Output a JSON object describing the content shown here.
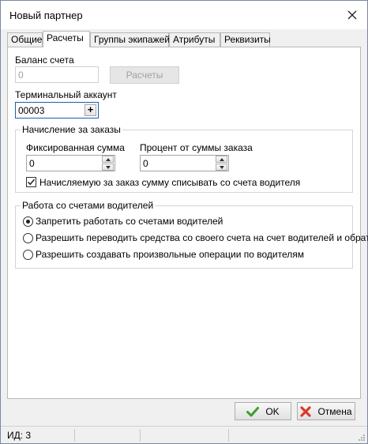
{
  "window": {
    "title": "Новый партнер"
  },
  "tabs": [
    {
      "label": "Общие"
    },
    {
      "label": "Расчеты"
    },
    {
      "label": "Группы экипажей"
    },
    {
      "label": "Атрибуты"
    },
    {
      "label": "Реквизиты"
    }
  ],
  "active_tab": "Расчеты",
  "balance": {
    "label": "Баланс счета",
    "value": "0",
    "button_label": "Расчеты"
  },
  "terminal": {
    "label": "Терминальный аккаунт",
    "value": "00003"
  },
  "accrual_group": {
    "title": "Начисление за заказы",
    "fixed_label": "Фиксированная сумма",
    "fixed_value": "0",
    "percent_label": "Процент от суммы заказа",
    "percent_value": "0",
    "checkbox_label": "Начисляемую за заказ сумму списывать со счета водителя",
    "checkbox_checked": true
  },
  "driver_accounts_group": {
    "title": "Работа со счетами водителей",
    "options": [
      {
        "label": "Запретить работать со счетами водителей",
        "selected": true
      },
      {
        "label": "Разрешить переводить средства со своего счета на счет водителей и обратно",
        "selected": false
      },
      {
        "label": "Разрешить создавать произвольные операции по водителям",
        "selected": false
      }
    ]
  },
  "footer": {
    "ok_label": "OK",
    "cancel_label": "Отмена"
  },
  "status": {
    "id_text": "ИД: 3"
  },
  "colors": {
    "ok_check": "#3aa02a",
    "cancel_x": "#d93a2a",
    "focus_border": "#1a5fb4"
  }
}
